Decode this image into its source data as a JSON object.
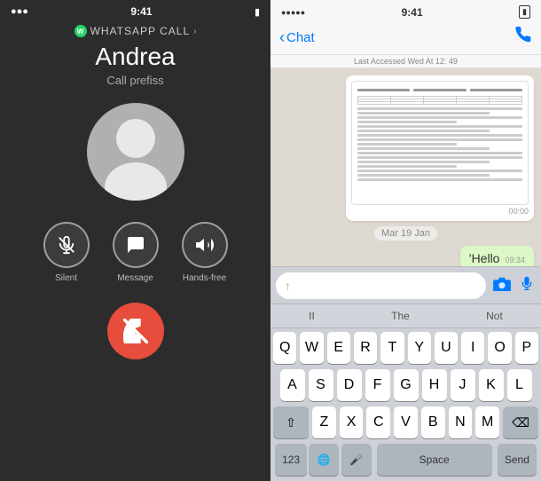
{
  "left": {
    "status_bar": {
      "time": "9:41",
      "signal": "●●●●●",
      "wifi": "wifi",
      "battery": "battery"
    },
    "call_type": "WHATSAPP CALL",
    "caller_name": "Andrea",
    "call_status": "Call prefiss",
    "actions": [
      {
        "id": "mute",
        "label": "Silent",
        "icon": "🎤"
      },
      {
        "id": "message",
        "label": "Message",
        "icon": "💬"
      },
      {
        "id": "handsfree",
        "label": "Hands-free",
        "icon": "🔊"
      }
    ],
    "decline_label": "decline"
  },
  "right": {
    "status_bar": {
      "signal": "●●●●●",
      "time": "9:41",
      "battery": "battery"
    },
    "header": {
      "back_label": "Chat",
      "last_accessed": "Last Accessed Wed At 12: 49",
      "phone_icon": "📞"
    },
    "messages": [
      {
        "type": "document",
        "timestamp": "00:00"
      },
      {
        "type": "date_divider",
        "label": "Mar 19 Jan"
      },
      {
        "type": "text",
        "text": "'Hello",
        "timestamp": "09:34"
      }
    ],
    "input": {
      "placeholder": "",
      "camera_icon": "📷",
      "mic_icon": "🎤"
    },
    "keyboard": {
      "toolbar": [
        "II",
        "The",
        "Not"
      ],
      "row1": [
        "Q",
        "W",
        "E",
        "R",
        "T",
        "Y",
        "U",
        "I",
        "O",
        "P"
      ],
      "row2": [
        "A",
        "S",
        "D",
        "F",
        "G",
        "H",
        "J",
        "K",
        "L"
      ],
      "row3": [
        "Z",
        "X",
        "C",
        "V",
        "B",
        "N",
        "M"
      ],
      "bottom": [
        "123",
        "globe",
        "mic",
        "Space",
        "Send"
      ]
    }
  }
}
